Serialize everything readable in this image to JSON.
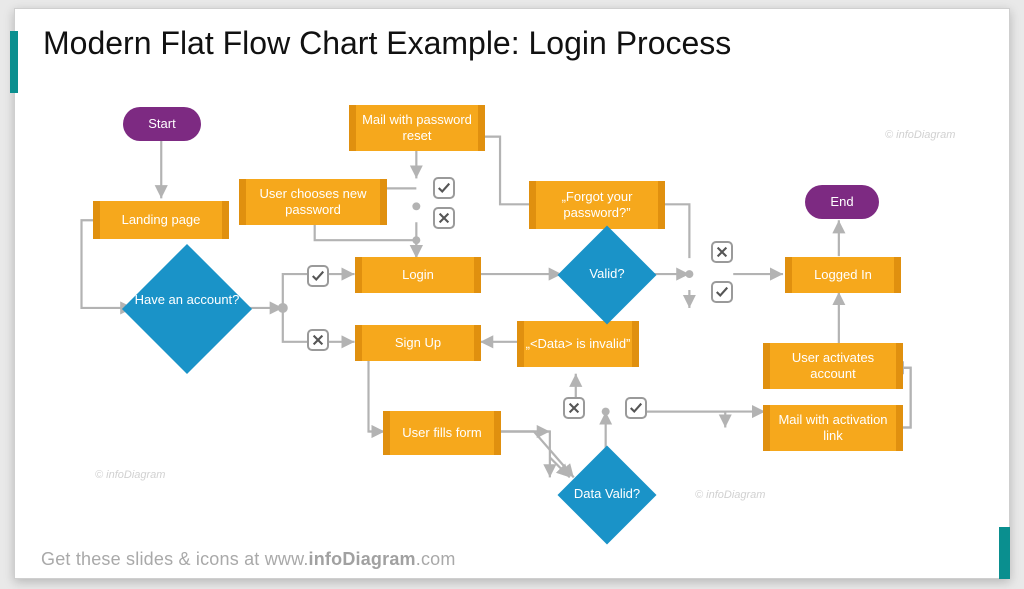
{
  "title": "Modern Flat Flow Chart Example: Login Process",
  "footer_prefix": "Get these slides & icons at ",
  "footer_domain_prefix": "www.",
  "footer_domain_bold": "infoDiagram",
  "footer_domain_suffix": ".com",
  "watermark": "© infoDiagram",
  "colors": {
    "process": "#f6a81c",
    "process_edge": "#e0900f",
    "terminator": "#7d2a82",
    "decision": "#1a93c8",
    "connector": "#b3b3b3",
    "accent": "#0a8f8f"
  },
  "nodes": {
    "start": {
      "type": "terminator",
      "label": "Start"
    },
    "end": {
      "type": "terminator",
      "label": "End"
    },
    "landing": {
      "type": "process",
      "label": "Landing page"
    },
    "choose_pw": {
      "type": "process",
      "label": "User chooses new password"
    },
    "mail_reset": {
      "type": "process",
      "label": "Mail with password reset"
    },
    "forgot_pw": {
      "type": "process",
      "label": "„Forgot your password?”"
    },
    "login": {
      "type": "process",
      "label": "Login"
    },
    "signup": {
      "type": "process",
      "label": "Sign Up"
    },
    "data_invalid": {
      "type": "process",
      "label": "„<Data> is invalid”"
    },
    "user_fills": {
      "type": "process",
      "label": "User fills form"
    },
    "logged_in": {
      "type": "process",
      "label": "Logged In"
    },
    "activates": {
      "type": "process",
      "label": "User activates account"
    },
    "mail_link": {
      "type": "process",
      "label": "Mail with activation link"
    },
    "have_acct": {
      "type": "decision",
      "label": "Have an account?"
    },
    "valid": {
      "type": "decision",
      "label": "Valid?"
    },
    "data_valid": {
      "type": "decision",
      "label": "Data Valid?"
    }
  },
  "chart_data": {
    "type": "flowchart",
    "title": "Login Process",
    "nodes": [
      {
        "id": "start",
        "kind": "terminator",
        "label": "Start"
      },
      {
        "id": "landing",
        "kind": "process",
        "label": "Landing page"
      },
      {
        "id": "have_acct",
        "kind": "decision",
        "label": "Have an account?"
      },
      {
        "id": "login",
        "kind": "process",
        "label": "Login"
      },
      {
        "id": "signup",
        "kind": "process",
        "label": "Sign Up"
      },
      {
        "id": "valid",
        "kind": "decision",
        "label": "Valid?"
      },
      {
        "id": "forgot_pw",
        "kind": "process",
        "label": "Forgot your password?"
      },
      {
        "id": "mail_reset",
        "kind": "process",
        "label": "Mail with password reset"
      },
      {
        "id": "choose_pw",
        "kind": "process",
        "label": "User chooses new password"
      },
      {
        "id": "user_fills",
        "kind": "process",
        "label": "User fills form"
      },
      {
        "id": "data_valid",
        "kind": "decision",
        "label": "Data Valid?"
      },
      {
        "id": "data_invalid",
        "kind": "process",
        "label": "<Data> is invalid"
      },
      {
        "id": "mail_link",
        "kind": "process",
        "label": "Mail with activation link"
      },
      {
        "id": "activates",
        "kind": "process",
        "label": "User activates account"
      },
      {
        "id": "logged_in",
        "kind": "process",
        "label": "Logged In"
      },
      {
        "id": "end",
        "kind": "terminator",
        "label": "End"
      }
    ],
    "edges": [
      {
        "from": "start",
        "to": "landing"
      },
      {
        "from": "landing",
        "to": "have_acct"
      },
      {
        "from": "have_acct",
        "to": "login",
        "label": "yes"
      },
      {
        "from": "have_acct",
        "to": "signup",
        "label": "no"
      },
      {
        "from": "login",
        "to": "valid"
      },
      {
        "from": "valid",
        "to": "logged_in",
        "label": "yes"
      },
      {
        "from": "valid",
        "to": "forgot_pw",
        "label": "no"
      },
      {
        "from": "forgot_pw",
        "to": "mail_reset"
      },
      {
        "from": "mail_reset",
        "to": "choose_pw",
        "label": "yes"
      },
      {
        "from": "mail_reset",
        "to": "login",
        "label": "no"
      },
      {
        "from": "choose_pw",
        "to": "login"
      },
      {
        "from": "signup",
        "to": "user_fills"
      },
      {
        "from": "user_fills",
        "to": "data_valid"
      },
      {
        "from": "data_valid",
        "to": "mail_link",
        "label": "yes"
      },
      {
        "from": "data_valid",
        "to": "data_invalid",
        "label": "no"
      },
      {
        "from": "data_invalid",
        "to": "signup"
      },
      {
        "from": "mail_link",
        "to": "activates"
      },
      {
        "from": "activates",
        "to": "logged_in"
      },
      {
        "from": "logged_in",
        "to": "end"
      }
    ]
  }
}
